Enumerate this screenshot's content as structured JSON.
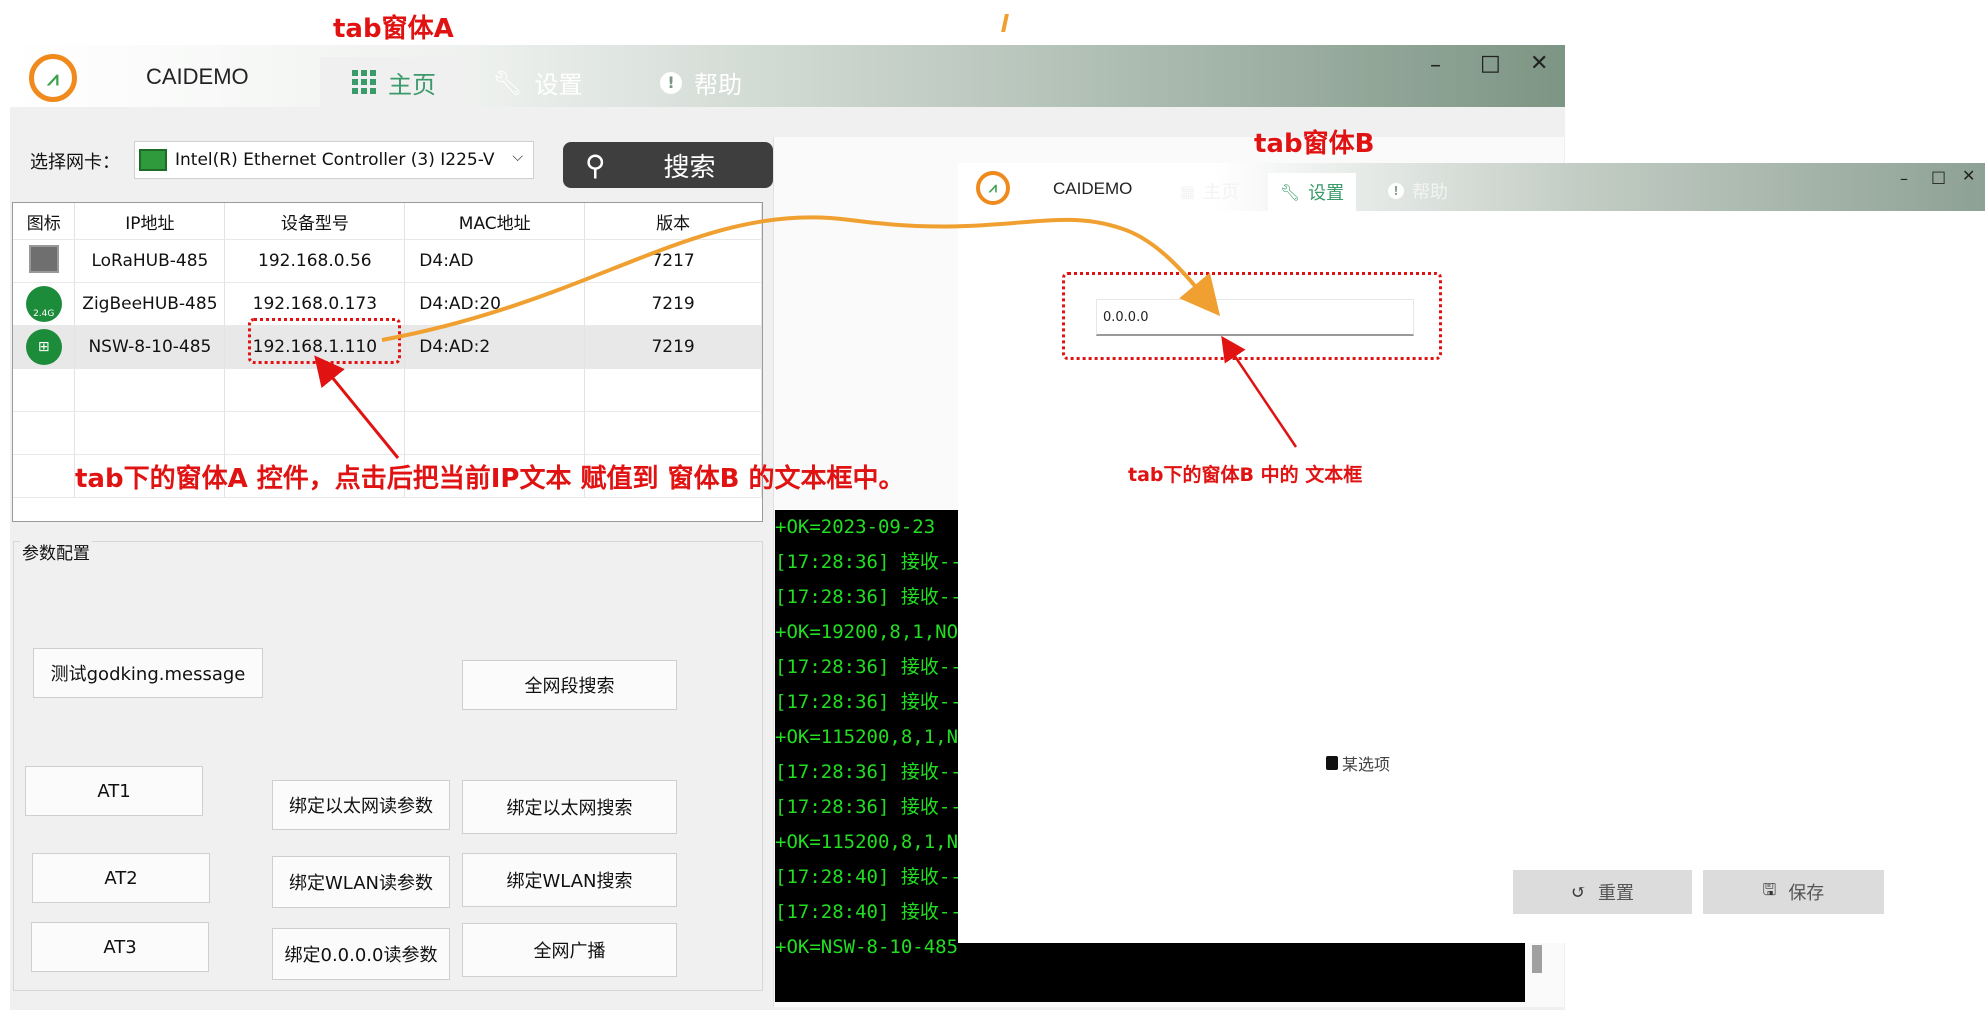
{
  "annotations": {
    "tab_a_label": "tab窗体A",
    "tab_b_label": "tab窗体B",
    "note_a": "tab下的窗体A 控件，点击后把当前IP文本 赋值到 窗体B 的文本框中。",
    "note_b": "tab下的窗体B 中的 文本框"
  },
  "window_a": {
    "app_name": "CAIDEMO",
    "tabs": [
      {
        "label": "主页",
        "icon": "grid-icon",
        "active": true
      },
      {
        "label": "设置",
        "icon": "wrench-icon",
        "active": false
      },
      {
        "label": "帮助",
        "icon": "info-icon",
        "active": false
      }
    ],
    "controls": {
      "minimize": "–",
      "maximize": "□",
      "close": "✕"
    },
    "nic_label": "选择网卡：",
    "nic_value": "Intel(R) Ethernet Controller (3) I225-V",
    "search_button": "搜索",
    "table": {
      "headers": [
        "图标",
        "IP地址",
        "设备型号",
        "MAC地址",
        "版本"
      ],
      "rows": [
        {
          "icon": "lan-device-icon",
          "name": "LoRaHUB-485",
          "ip": "192.168.0.56",
          "mac": "D4:AD",
          "version": "7217"
        },
        {
          "icon": "wifi-device-icon",
          "name": "ZigBeeHUB-485",
          "ip": "192.168.0.173",
          "mac": "D4:AD:20",
          "version": "7219"
        },
        {
          "icon": "ethernet-device-icon",
          "name": "NSW-8-10-485",
          "ip": "192.168.1.110",
          "mac": "D4:AD:2",
          "version": "7219"
        }
      ]
    },
    "params_label": "参数配置",
    "buttons": {
      "test": "测试godking.message",
      "full_segment_search": "全网段搜索",
      "at1": "AT1",
      "at2": "AT2",
      "at3": "AT3",
      "bind_eth_read": "绑定以太网读参数",
      "bind_eth_search": "绑定以太网搜索",
      "bind_wlan_read": "绑定WLAN读参数",
      "bind_wlan_search": "绑定WLAN搜索",
      "bind_zero_read": "绑定0.0.0.0读参数",
      "broadcast": "全网广播"
    },
    "log_lines": [
      "+OK=2023-09-23",
      " [17:28:36] 接收-->",
      " [17:28:36] 接收-->",
      "+OK=19200,8,1,NO",
      " [17:28:36] 接收-->",
      " [17:28:36] 接收-->",
      "+OK=115200,8,1,N",
      " [17:28:36] 接收-->",
      " [17:28:36] 接收-->",
      "+OK=115200,8,1,N",
      " [17:28:40] 接收-->",
      " [17:28:40] 接收-->",
      "+OK=NSW-8-10-485"
    ]
  },
  "window_b": {
    "app_name": "CAIDEMO",
    "tabs": [
      {
        "label": "主页",
        "icon": "grid-icon",
        "active": false
      },
      {
        "label": "设置",
        "icon": "wrench-icon",
        "active": true
      },
      {
        "label": "帮助",
        "icon": "info-icon",
        "active": false
      }
    ],
    "controls": {
      "minimize": "–",
      "maximize": "□",
      "close": "✕"
    },
    "ip_input_value": "0.0.0.0",
    "checkbox_label": "某选项",
    "reset_button": "重置",
    "save_button": "保存"
  },
  "colors": {
    "annotation_red": "#e01212",
    "arrow_orange": "#f0a030",
    "log_green": "#22dd22",
    "logo_orange": "#f08a1c"
  }
}
